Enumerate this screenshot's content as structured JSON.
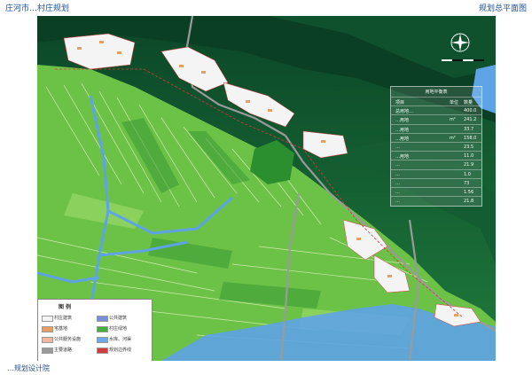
{
  "title": {
    "left": "庄河市…村庄规划",
    "right": "规划总平面图"
  },
  "bottom": {
    "left": "…规划设计院",
    "right": ""
  },
  "stats": {
    "title": "用地平衡表",
    "rows": [
      {
        "a": "项目",
        "b": "单位",
        "c": "数量"
      },
      {
        "a": "总用地…",
        "b": "",
        "c": "400.0"
      },
      {
        "a": "…用地",
        "b": "m²",
        "c": "241.2"
      },
      {
        "a": "…用地",
        "b": "",
        "c": "33.7"
      },
      {
        "a": "…用地",
        "b": "m²",
        "c": "158.0"
      },
      {
        "a": "…",
        "b": "",
        "c": "23.5"
      },
      {
        "a": "…用地",
        "b": "",
        "c": "11.0"
      },
      {
        "a": "…",
        "b": "",
        "c": "21.9"
      },
      {
        "a": "…",
        "b": "",
        "c": "1.0"
      },
      {
        "a": "…",
        "b": "",
        "c": "73"
      },
      {
        "a": "…",
        "b": "",
        "c": "1.56"
      },
      {
        "a": "…",
        "b": "",
        "c": "21.8"
      }
    ]
  },
  "legend": {
    "title": "图 例",
    "items": [
      {
        "label": "村庄建筑",
        "color": "#f4f4f4"
      },
      {
        "label": "公共建筑",
        "color": "#7b8fd8"
      },
      {
        "label": "宅基地",
        "color": "#e8a062"
      },
      {
        "label": "村庄绿地",
        "color": "#45ad3f"
      },
      {
        "label": "公共服务设施",
        "color": "#f2b8a0"
      },
      {
        "label": "水库、河渠",
        "color": "#6ea9e6"
      },
      {
        "label": "主要道路",
        "color": "#9a9a9a"
      },
      {
        "label": "规划边界线",
        "color": "#d23b3b"
      }
    ]
  },
  "colors": {
    "mountain_dark": "#0d4d2a",
    "mountain_mid": "#2e8a45",
    "field_light": "#8ccf59",
    "field_dark": "#3a9a35",
    "water": "#5ea3e6",
    "road": "#9a9a9a"
  }
}
